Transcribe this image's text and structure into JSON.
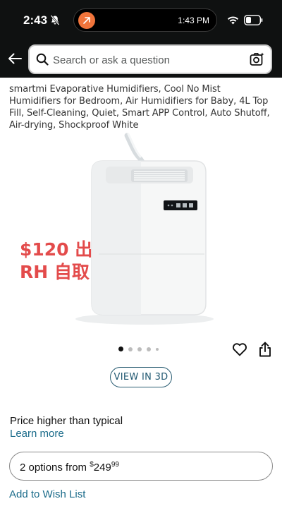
{
  "status_bar": {
    "time": "2:43",
    "island_time": "1:43 PM",
    "icons": [
      "bell-off-icon",
      "wifi-icon",
      "battery-icon"
    ]
  },
  "search": {
    "placeholder": "Search or ask a question",
    "icons": [
      "back-arrow-icon",
      "search-icon",
      "camera-icon"
    ]
  },
  "product": {
    "title": "smartmi Evaporative Humidifiers, Cool No Mist Humidifiers for Bedroom, Air Humidifiers for Baby, 4L Top Fill, Self-Cleaning, Quiet, Smart APP Control, Auto Shutoff, Air-drying, Shockproof White",
    "overlay_line1": "$120 出",
    "overlay_line2": "RH 自取",
    "image_count": 5,
    "active_image": 1
  },
  "actions": {
    "view_3d": "VIEW IN 3D",
    "price_note": "Price higher than typical",
    "learn_more": "Learn more",
    "options_prefix": "2 options from ",
    "options_price_symbol": "$",
    "options_price_whole": "249",
    "options_price_fraction": "99",
    "wishlist": "Add to Wish List"
  },
  "colors": {
    "header_bg": "#0f1111",
    "link": "#1a6b8a",
    "overlay_text": "#e34b4b",
    "island_app": "#f0743b"
  }
}
